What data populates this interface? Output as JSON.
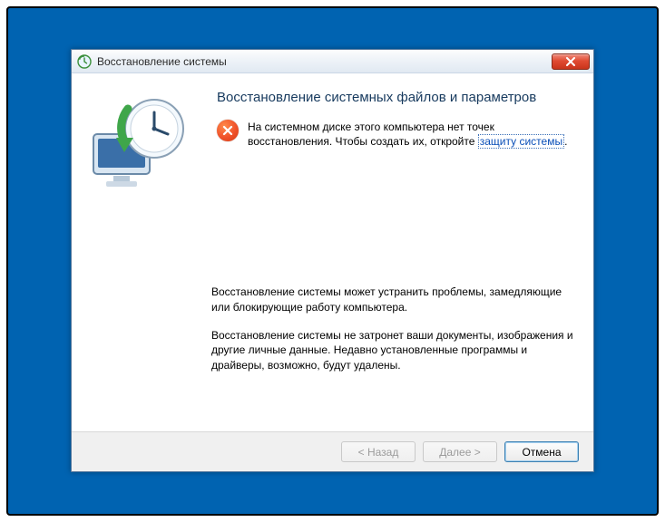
{
  "window": {
    "title": "Восстановление системы"
  },
  "content": {
    "heading": "Восстановление системных файлов и параметров",
    "error_prefix": "На системном диске этого компьютера нет точек восстановления. Чтобы создать их, откройте ",
    "error_link": "защиту системы",
    "error_suffix": ".",
    "para1": "Восстановление системы может устранить проблемы, замедляющие или блокирующие работу компьютера.",
    "para2": "Восстановление системы не затронет ваши документы, изображения и другие личные данные. Недавно установленные программы и драйверы, возможно, будут удалены."
  },
  "buttons": {
    "back": "< Назад",
    "next": "Далее >",
    "cancel": "Отмена"
  }
}
